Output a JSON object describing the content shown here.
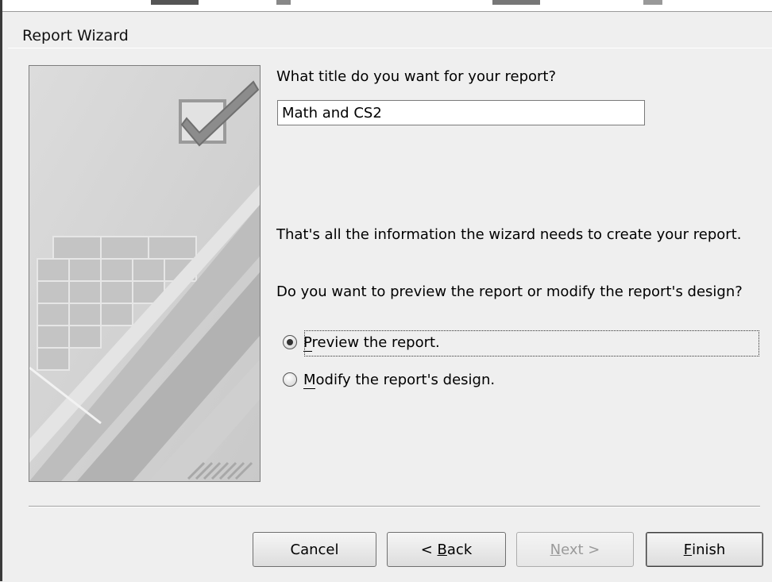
{
  "window": {
    "title": "Report Wizard"
  },
  "form": {
    "title_prompt": "What title do you want for your report?",
    "title_value": "Math and CS2",
    "info_text": "That's all the information the wizard needs to create your report.",
    "question_text": "Do you want to preview the report or modify the report's design?",
    "options": [
      {
        "mnemonic": "P",
        "rest": "review the report.",
        "selected": true
      },
      {
        "mnemonic": "M",
        "rest": "odify the report's design.",
        "selected": false
      }
    ]
  },
  "buttons": {
    "cancel": "Cancel",
    "back_prefix": "< ",
    "back_mnemonic": "B",
    "back_rest": "ack",
    "next_mnemonic": "N",
    "next_rest": "ext >",
    "finish_mnemonic": "F",
    "finish_rest": "inish"
  },
  "icons": {
    "art": "report-wizard-checkmark-grid-art",
    "checkmark": "checkmark-icon"
  }
}
